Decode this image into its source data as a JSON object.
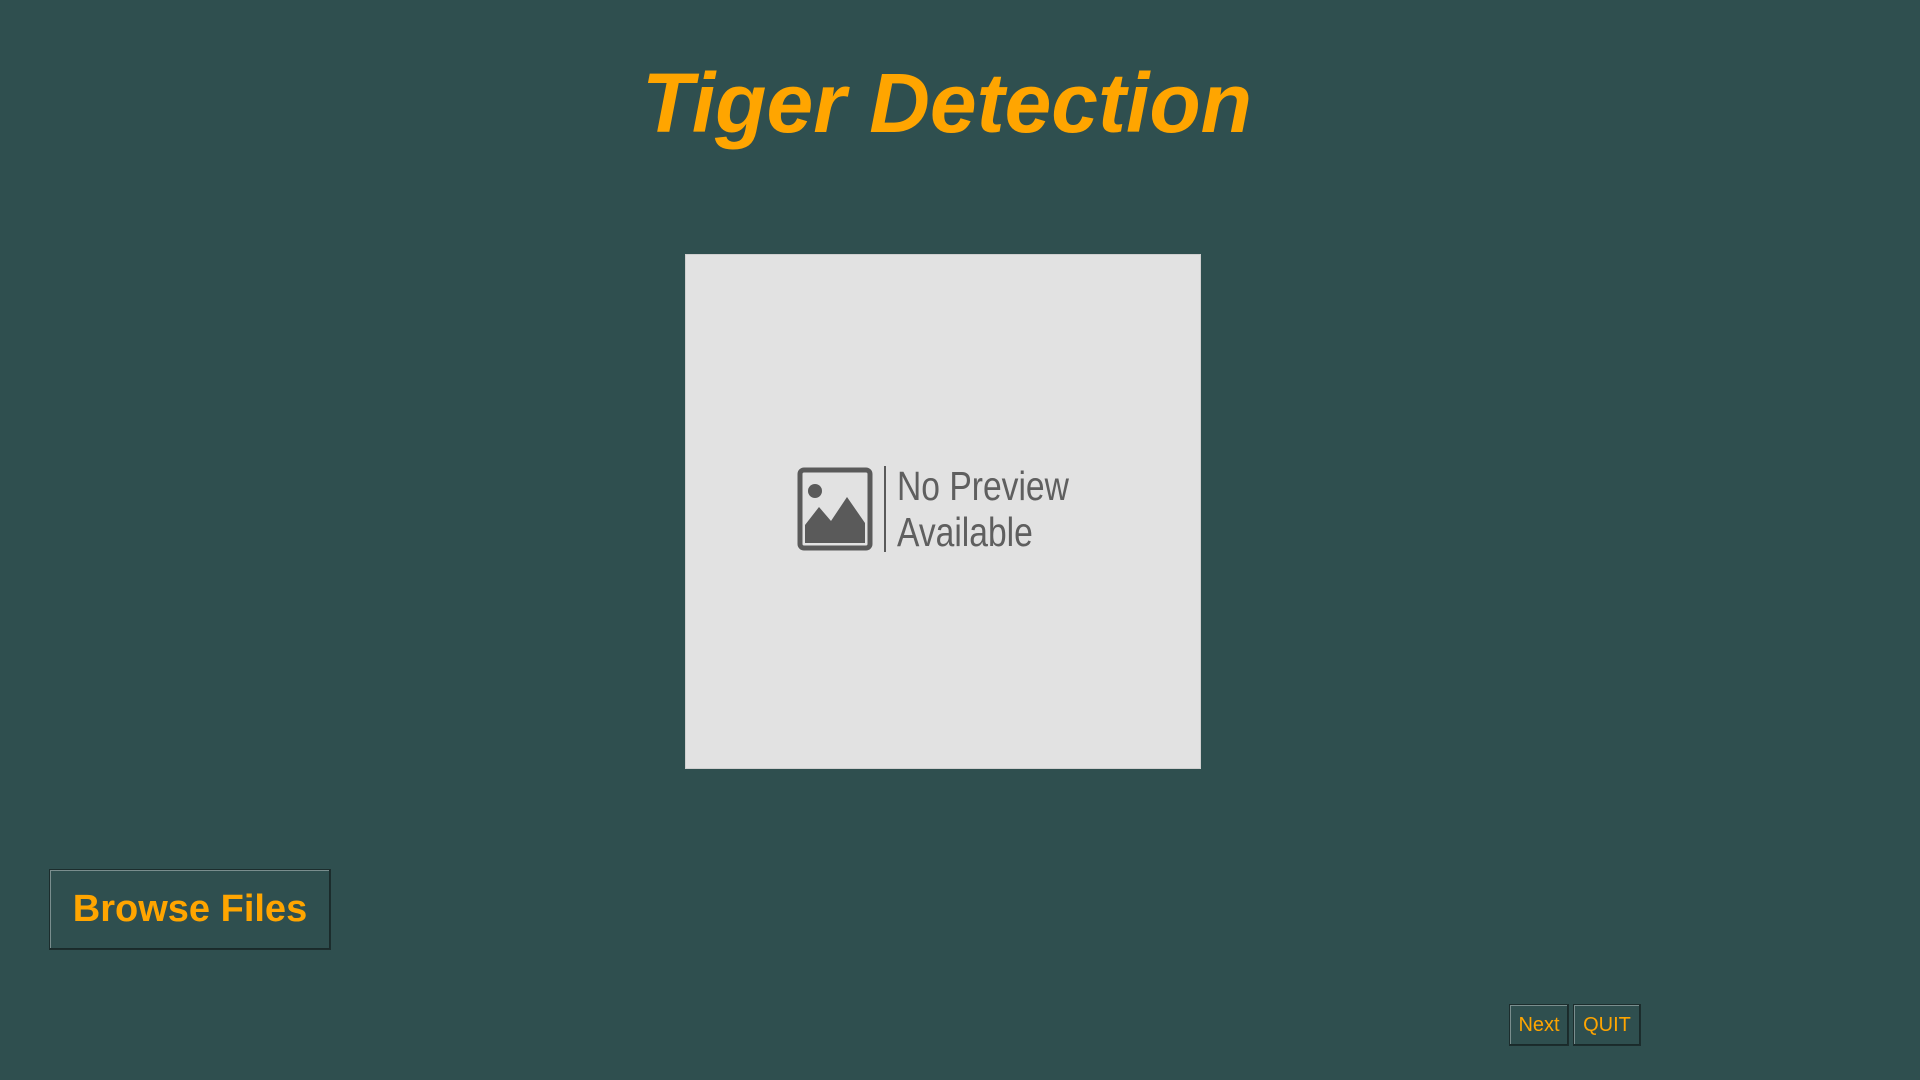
{
  "app": {
    "title": "Tiger Detection"
  },
  "preview": {
    "line1": "No Preview",
    "line2": "Available",
    "icon": "image-placeholder-icon"
  },
  "buttons": {
    "browse_label": "Browse Files",
    "next_label": "Next",
    "quit_label": "QUIT"
  },
  "colors": {
    "background": "#2f4f4f",
    "accent": "#ffa500",
    "preview_bg": "#e2e2e2"
  }
}
